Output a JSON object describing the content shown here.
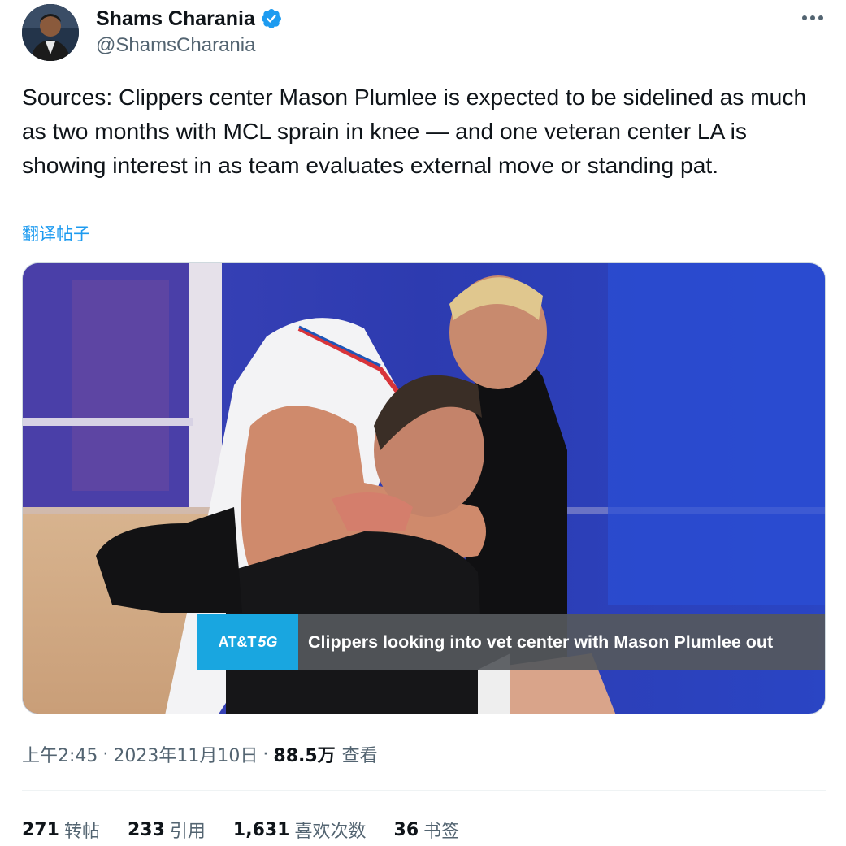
{
  "author": {
    "name": "Shams Charania",
    "handle": "@ShamsCharania",
    "verified": true
  },
  "tweet": {
    "text": "Sources: Clippers center Mason Plumlee is expected to be sidelined as much as two months with MCL sprain in knee — and one veteran center LA is showing interest in as team evaluates external move or standing pat.",
    "translate_label": "翻译帖子"
  },
  "media": {
    "caption_logo": "AT&T",
    "caption_logo_5g": "5G",
    "caption_text": "Clippers looking into vet center with Mason Plumlee out"
  },
  "meta": {
    "time": "上午2:45",
    "separator": "·",
    "date": "2023年11月10日",
    "views_count": "88.5万",
    "views_label": "查看"
  },
  "stats": [
    {
      "count": "271",
      "label": "转帖"
    },
    {
      "count": "233",
      "label": "引用"
    },
    {
      "count": "1,631",
      "label": "喜欢次数"
    },
    {
      "count": "36",
      "label": "书签"
    }
  ],
  "colors": {
    "link": "#1d9bf0",
    "secondary_text": "#536471",
    "verified": "#1d9bf0",
    "caption_logo_bg": "#19a6e0"
  },
  "icons": {
    "verified": "verified-badge-icon",
    "more": "more-horizontal-icon"
  }
}
